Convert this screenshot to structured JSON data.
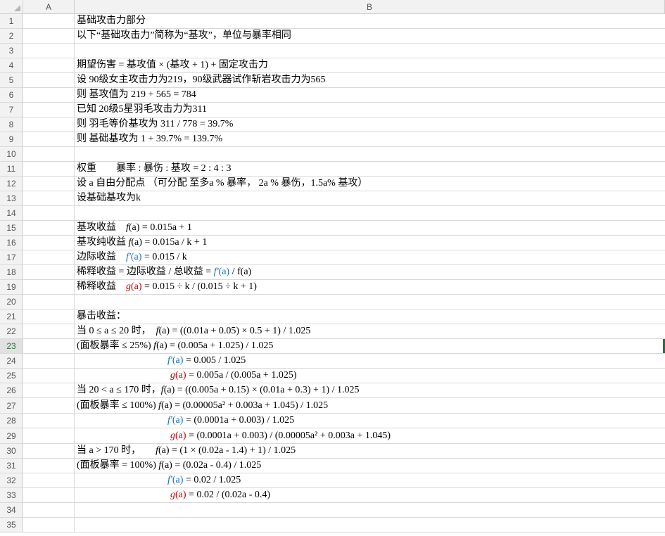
{
  "columns": [
    "A",
    "B"
  ],
  "rows": [
    {
      "n": "1",
      "text": "基础攻击力部分"
    },
    {
      "n": "2",
      "text": "以下“基础攻击力”简称为“基攻”，单位与暴率相同"
    },
    {
      "n": "3",
      "text": ""
    },
    {
      "n": "4",
      "text": "期望伤害 = 基攻值 × (基攻 + 1) + 固定攻击力"
    },
    {
      "n": "5",
      "text": "设 90级女主攻击力为219，90级武器试作斩岩攻击力为565"
    },
    {
      "n": "6",
      "text": "则 基攻值为 219 + 565 = 784"
    },
    {
      "n": "7",
      "text": "已知 20级5星羽毛攻击力为311"
    },
    {
      "n": "8",
      "text": "则 羽毛等价基攻为 311 / 778 = 39.7%"
    },
    {
      "n": "9",
      "text": "则 基础基攻为 1 + 39.7% = 139.7%"
    },
    {
      "n": "10",
      "text": ""
    },
    {
      "n": "11",
      "text": "权重　　暴率 : 暴伤 : 基攻 = 2 : 4 : 3"
    },
    {
      "n": "12",
      "text": "设 a 自由分配点 （可分配 至多a % 暴率， 2a % 暴伤，1.5a% 基攻）"
    },
    {
      "n": "13",
      "text": "设基础基攻为k"
    },
    {
      "n": "14",
      "text": ""
    },
    {
      "n": "15",
      "pre": "基攻收益　",
      "fn": "f",
      "post": "(a) = 0.015a + 1"
    },
    {
      "n": "16",
      "pre": "基攻纯收益 ",
      "fn": "f",
      "post": "(a) = 0.015a / k + 1"
    },
    {
      "n": "17",
      "pre": "边际收益　",
      "fn": "f'",
      "fnarg": "(a)",
      "color": "blue",
      "post": " = 0.015 / k"
    },
    {
      "n": "18",
      "pre": "稀释收益 = 边际收益 / 总收益 = ",
      "fn": "f'",
      "fnarg": "(a)",
      "color": "blue",
      "post": " / f(a)"
    },
    {
      "n": "19",
      "pre": "稀释收益　",
      "fn": "g",
      "fnarg": "(a)",
      "color": "red",
      "post": " =  0.015 ÷ k / (0.015 ÷ k + 1)"
    },
    {
      "n": "20",
      "text": ""
    },
    {
      "n": "21",
      "text": "暴击收益："
    },
    {
      "n": "22",
      "pre": "当 0 ≤ a ≤ 20 时，　",
      "fn": "f",
      "post": "(a) = ((0.01a + 0.05) × 0.5 + 1) / 1.025"
    },
    {
      "n": "23",
      "pre": "(面板暴率 ≤ 25%)  ",
      "fn": "f",
      "post": "(a) = (0.005a + 1.025) / 1.025",
      "selected": true
    },
    {
      "n": "24",
      "indent": true,
      "fn": "f'",
      "fnarg": "(a)",
      "color": "blue",
      "post": " = 0.005 / 1.025"
    },
    {
      "n": "25",
      "indent": true,
      "fn": "g",
      "fnarg": "(a)",
      "color": "red",
      "post": " = 0.005a / (0.005a + 1.025)"
    },
    {
      "n": "26",
      "pre": "当 20 < a ≤ 170 时，",
      "fn": "f",
      "post": "(a) = ((0.005a + 0.15) × (0.01a + 0.3) + 1) / 1.025"
    },
    {
      "n": "27",
      "pre": "(面板暴率 ≤ 100%) ",
      "fn": "f",
      "post": "(a) = (0.00005a² + 0.003a + 1.045) / 1.025",
      "tall": true
    },
    {
      "n": "28",
      "indent": true,
      "fn": "f'",
      "fnarg": "(a)",
      "color": "blue",
      "post": " = (0.0001a + 0.003) / 1.025"
    },
    {
      "n": "29",
      "indent": true,
      "fn": "g",
      "fnarg": "(a)",
      "color": "red",
      "post": " = (0.0001a + 0.003) / (0.00005a² + 0.003a + 1.045)",
      "tall": true
    },
    {
      "n": "30",
      "pre": "当 a > 170 时，　　",
      "fn": "f",
      "post": "(a) = (1 × (0.02a - 1.4) + 1) / 1.025"
    },
    {
      "n": "31",
      "pre": "(面板暴率 = 100%) ",
      "fn": "f",
      "post": "(a) = (0.02a - 0.4) / 1.025"
    },
    {
      "n": "32",
      "indent": true,
      "fn": "f'",
      "fnarg": "(a)",
      "color": "blue",
      "post": " = 0.02 / 1.025"
    },
    {
      "n": "33",
      "indent": true,
      "fn": "g",
      "fnarg": "(a)",
      "color": "red",
      "post": " = 0.02 / (0.02a - 0.4)"
    },
    {
      "n": "34",
      "text": ""
    },
    {
      "n": "35",
      "text": ""
    }
  ]
}
